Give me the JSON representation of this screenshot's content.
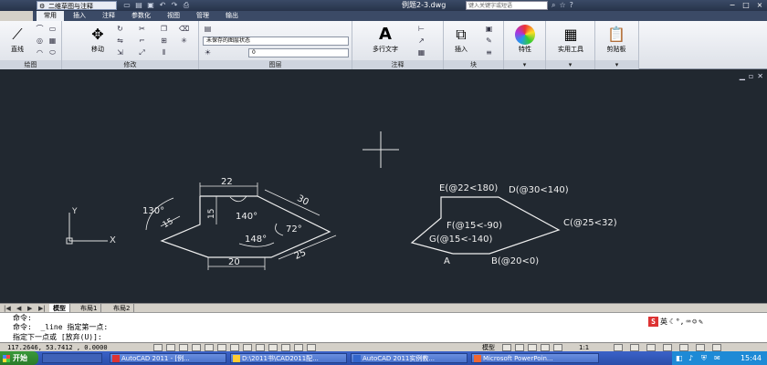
{
  "title_bar": {
    "workspace": "二维草图与注释",
    "document_title": "例题2-3.dwg",
    "search_placeholder": "键入关键字或短语",
    "qat_icons": [
      "new-icon",
      "open-icon",
      "save-icon",
      "undo-icon",
      "redo-icon",
      "print-icon"
    ],
    "window_controls": [
      "−",
      "□",
      "×"
    ]
  },
  "ribbon_tabs": [
    "常用",
    "插入",
    "注释",
    "参数化",
    "视图",
    "管理",
    "输出"
  ],
  "ribbon": {
    "draw_panel": {
      "label": "绘图",
      "line_button": "直线"
    },
    "modify_panel": {
      "label": "修改",
      "move_button": "移动"
    },
    "layers_panel": {
      "label": "图层",
      "layer_state": "未保存的图层状态",
      "current_layer": "0"
    },
    "annotation_panel": {
      "label": "注释",
      "mtext_button": "多行文字"
    },
    "block_panel": {
      "label": "块",
      "insert_button": "插入"
    },
    "properties_button": "特性",
    "utilities_button": "实用工具",
    "clipboard_button": "剪贴板"
  },
  "drawing": {
    "left_shape_labels": {
      "top": "22",
      "right_slant": "30",
      "inner_height": "15",
      "left_slant": "15",
      "angle_outer": "130°",
      "angle_top": "140°",
      "angle_right": "72°",
      "angle_bottom": "148°",
      "bottom": "20",
      "bottom_right": "25"
    },
    "right_shape_labels": {
      "e": "E(@22<180)",
      "d": "D(@30<140)",
      "c": "C(@25<32)",
      "f": "F(@15<-90)",
      "g": "G(@15<-140)",
      "a": "A",
      "b": "B(@20<0)"
    },
    "ucs_x": "X",
    "ucs_y": "Y"
  },
  "layout_tabs": [
    "模型",
    "布局1",
    "布局2"
  ],
  "command": {
    "lines": [
      "命令:",
      "命令:  _line 指定第一点:",
      "指定下一点或 [放弃(U)]:"
    ],
    "ime": "英"
  },
  "status": {
    "coords": "117.2646,  53.7412  ,  0.0000",
    "model_label": "模型",
    "scale": "1:1"
  },
  "taskbar": {
    "start": "开始",
    "tasks": [
      "AutoCAD 2011 - [例...",
      "D:\\2011书\\CAD2011配...",
      "AutoCAD 2011实例教...",
      "Microsoft PowerPoin..."
    ],
    "clock": "15:44"
  }
}
